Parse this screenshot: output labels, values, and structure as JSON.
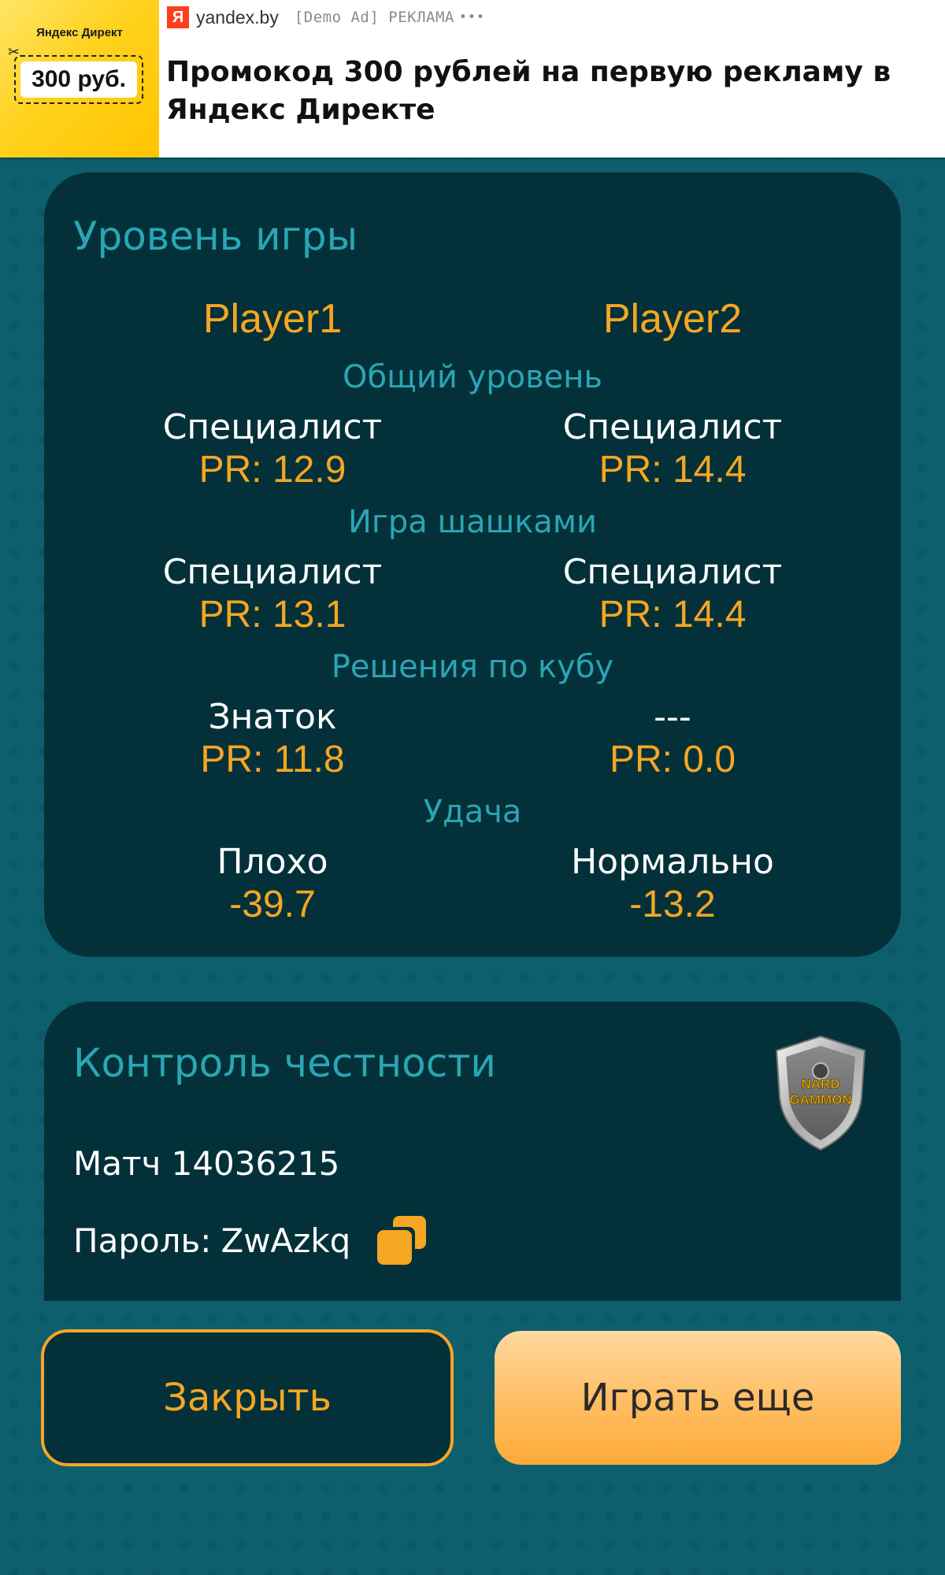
{
  "ad": {
    "image_brand": "Яндекс Директ",
    "image_coupon": "300 руб.",
    "logo_letter": "Я",
    "domain": "yandex.by",
    "label": "[Demo Ad] РЕКЛАМА",
    "more": "•••",
    "title": "Промокод 300 рублей на первую рекламу в Яндекс Директе"
  },
  "level_card": {
    "title": "Уровень игры",
    "players": [
      "Player1",
      "Player2"
    ],
    "sections": [
      {
        "label": "Общий уровень",
        "left": {
          "rank": "Специалист",
          "value": "PR: 12.9"
        },
        "right": {
          "rank": "Специалист",
          "value": "PR: 14.4"
        }
      },
      {
        "label": "Игра шашками",
        "left": {
          "rank": "Специалист",
          "value": "PR: 13.1"
        },
        "right": {
          "rank": "Специалист",
          "value": "PR: 14.4"
        }
      },
      {
        "label": "Решения по кубу",
        "left": {
          "rank": "Знаток",
          "value": "PR: 11.8"
        },
        "right": {
          "rank": "---",
          "value": "PR: 0.0"
        }
      },
      {
        "label": "Удача",
        "left": {
          "rank": "Плохо",
          "value": "-39.7"
        },
        "right": {
          "rank": "Нормально",
          "value": "-13.2"
        }
      }
    ]
  },
  "fairness_card": {
    "title": "Контроль честности",
    "match": "Матч 14036215",
    "password_label": "Пароль:",
    "password_value": "ZwAzkq",
    "shield_text_top": "NARD",
    "shield_text_bottom": "GAMMON"
  },
  "buttons": {
    "close": "Закрыть",
    "play_again": "Играть еще"
  },
  "colors": {
    "background": "#0d5f6d",
    "card": "#043139",
    "accent_orange": "#f5a623",
    "accent_teal": "#2aa5b5"
  }
}
